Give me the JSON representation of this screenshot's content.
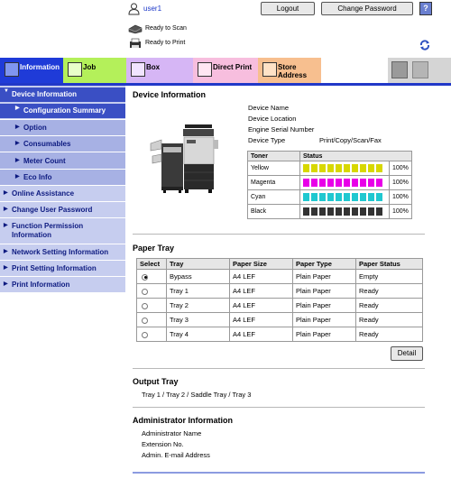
{
  "header": {
    "user_name": "user1",
    "logout_label": "Logout",
    "change_password_label": "Change Password",
    "help_label": "?",
    "status": [
      {
        "icon": "scanner-icon",
        "text": "Ready to Scan"
      },
      {
        "icon": "printer-icon",
        "text": "Ready to Print"
      }
    ]
  },
  "tabs": [
    {
      "label": "Information",
      "icon": "information-icon",
      "color": "#1f3bd8",
      "selected": true
    },
    {
      "label": "Job",
      "icon": "job-icon",
      "color": "#b4f05a"
    },
    {
      "label": "Box",
      "icon": "box-icon",
      "color": "#d6b6f5"
    },
    {
      "label": "Direct Print",
      "icon": "direct-print-icon",
      "color": "#f7bede"
    },
    {
      "label": "Store Address",
      "line1": "Store",
      "line2": "Address",
      "icon": "store-address-icon",
      "color": "#f7bf8f"
    }
  ],
  "sidebar": {
    "items": [
      {
        "label": "Device Information",
        "selected": true
      },
      {
        "label": "Configuration Summary",
        "sub": true,
        "selected": true
      },
      {
        "label": "Option",
        "sub": true
      },
      {
        "label": "Consumables",
        "sub": true
      },
      {
        "label": "Meter Count",
        "sub": true
      },
      {
        "label": "Eco Info",
        "sub": true
      },
      {
        "label": "Online Assistance"
      },
      {
        "label": "Change User Password"
      },
      {
        "label": "Function Permission Information",
        "line1": "Function Permission",
        "line2": "Information"
      },
      {
        "label": "Network Setting Information"
      },
      {
        "label": "Print Setting Information"
      },
      {
        "label": "Print Information"
      }
    ]
  },
  "device": {
    "title": "Device Information",
    "fields": [
      {
        "label": "Device Name",
        "value": ""
      },
      {
        "label": "Device Location",
        "value": ""
      },
      {
        "label": "Engine Serial Number",
        "value": ""
      },
      {
        "label": "Device Type",
        "value": "Print/Copy/Scan/Fax"
      }
    ],
    "toner_header": [
      "Toner",
      "Status"
    ],
    "toners": [
      {
        "name": "Yellow",
        "color": "#d8d800",
        "level": "100%"
      },
      {
        "name": "Magenta",
        "color": "#e800e8",
        "level": "100%"
      },
      {
        "name": "Cyan",
        "color": "#20c8d0",
        "level": "100%"
      },
      {
        "name": "Black",
        "color": "#333333",
        "level": "100%"
      }
    ]
  },
  "paper_tray": {
    "title": "Paper Tray",
    "headers": [
      "Select",
      "Tray",
      "Paper Size",
      "Paper Type",
      "Paper Status"
    ],
    "rows": [
      {
        "selected": true,
        "tray": "Bypass",
        "size": "A4 LEF",
        "type": "Plain Paper",
        "status": "Empty"
      },
      {
        "selected": false,
        "tray": "Tray 1",
        "size": "A4 LEF",
        "type": "Plain Paper",
        "status": "Ready"
      },
      {
        "selected": false,
        "tray": "Tray 2",
        "size": "A4 LEF",
        "type": "Plain Paper",
        "status": "Ready"
      },
      {
        "selected": false,
        "tray": "Tray 3",
        "size": "A4 LEF",
        "type": "Plain Paper",
        "status": "Ready"
      },
      {
        "selected": false,
        "tray": "Tray 4",
        "size": "A4 LEF",
        "type": "Plain Paper",
        "status": "Ready"
      }
    ],
    "detail_label": "Detail"
  },
  "output_tray": {
    "title": "Output Tray",
    "value": "Tray 1 / Tray 2 / Saddle Tray / Tray 3"
  },
  "admin": {
    "title": "Administrator Information",
    "fields": [
      "Administrator Name",
      "Extension No.",
      "Admin. E-mail Address"
    ]
  }
}
